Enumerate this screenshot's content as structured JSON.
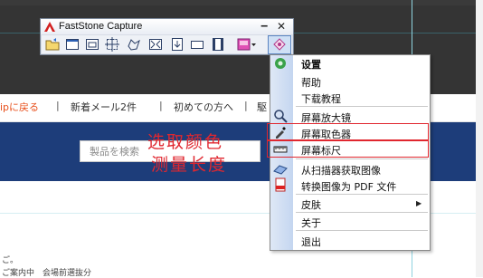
{
  "window": {
    "title": "FastStone Capture",
    "minimize_glyph": "‒",
    "close_glyph": "✕",
    "tools": [
      {
        "name": "open-icon"
      },
      {
        "name": "capture-window-icon"
      },
      {
        "name": "capture-object-icon"
      },
      {
        "name": "capture-region-icon"
      },
      {
        "name": "capture-freehand-icon"
      },
      {
        "name": "capture-fullscreen-icon"
      },
      {
        "name": "capture-scrolling-icon"
      },
      {
        "name": "capture-fixed-region-icon"
      },
      {
        "name": "record-video-icon"
      },
      {
        "name": "output-icon"
      },
      {
        "name": "settings-menu-icon"
      }
    ]
  },
  "page": {
    "nav": {
      "home": "ipに戻る",
      "mail": "新着メール2件",
      "first_time": "初めての方へ",
      "partial": "駆"
    },
    "search_placeholder": "製品を検索",
    "footer_1": "ご。",
    "footer_2": "ご案内中　会場前選抜分"
  },
  "menu": {
    "items": [
      {
        "label": "设置",
        "icon": "settings-gear-icon"
      },
      {
        "label": "帮助"
      },
      {
        "label": "下载教程"
      },
      {
        "label": "屏幕放大镜",
        "icon": "magnifier-icon"
      },
      {
        "label": "屏幕取色器",
        "icon": "color-picker-icon"
      },
      {
        "label": "屏幕标尺",
        "icon": "ruler-icon"
      },
      {
        "label": "从扫描器获取图像",
        "icon": "scanner-icon"
      },
      {
        "label": "转换图像为 PDF 文件",
        "icon": "pdf-icon"
      },
      {
        "label": "皮肤"
      },
      {
        "label": "关于"
      },
      {
        "label": "退出"
      }
    ],
    "submenu_arrow": "▶"
  },
  "annotations": {
    "color_picker": "选取颜色",
    "ruler": "测量长度",
    "color": "#e0272f"
  }
}
